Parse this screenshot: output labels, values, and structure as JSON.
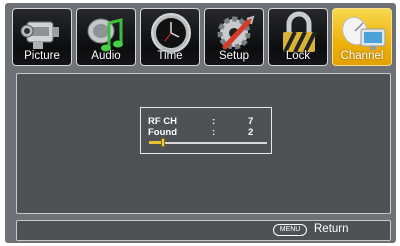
{
  "menu": {
    "tabs": [
      {
        "label": "Picture",
        "icon": "camcorder-icon"
      },
      {
        "label": "Audio",
        "icon": "music-note-icon"
      },
      {
        "label": "Time",
        "icon": "clock-icon"
      },
      {
        "label": "Setup",
        "icon": "gear-wrench-icon"
      },
      {
        "label": "Lock",
        "icon": "padlock-icon"
      },
      {
        "label": "Channel",
        "icon": "satellite-monitor-icon",
        "selected": true
      }
    ]
  },
  "scan": {
    "rf_ch_label": "RF CH",
    "rf_ch_sep": ":",
    "rf_ch_value": "7",
    "found_label": "Found",
    "found_sep": ":",
    "found_value": "2",
    "progress_fraction": 0.12
  },
  "footer": {
    "menu_key": "MENU",
    "return_label": "Return"
  },
  "colors": {
    "active_tab": "#eeb20c",
    "panel": "#4e5257"
  }
}
